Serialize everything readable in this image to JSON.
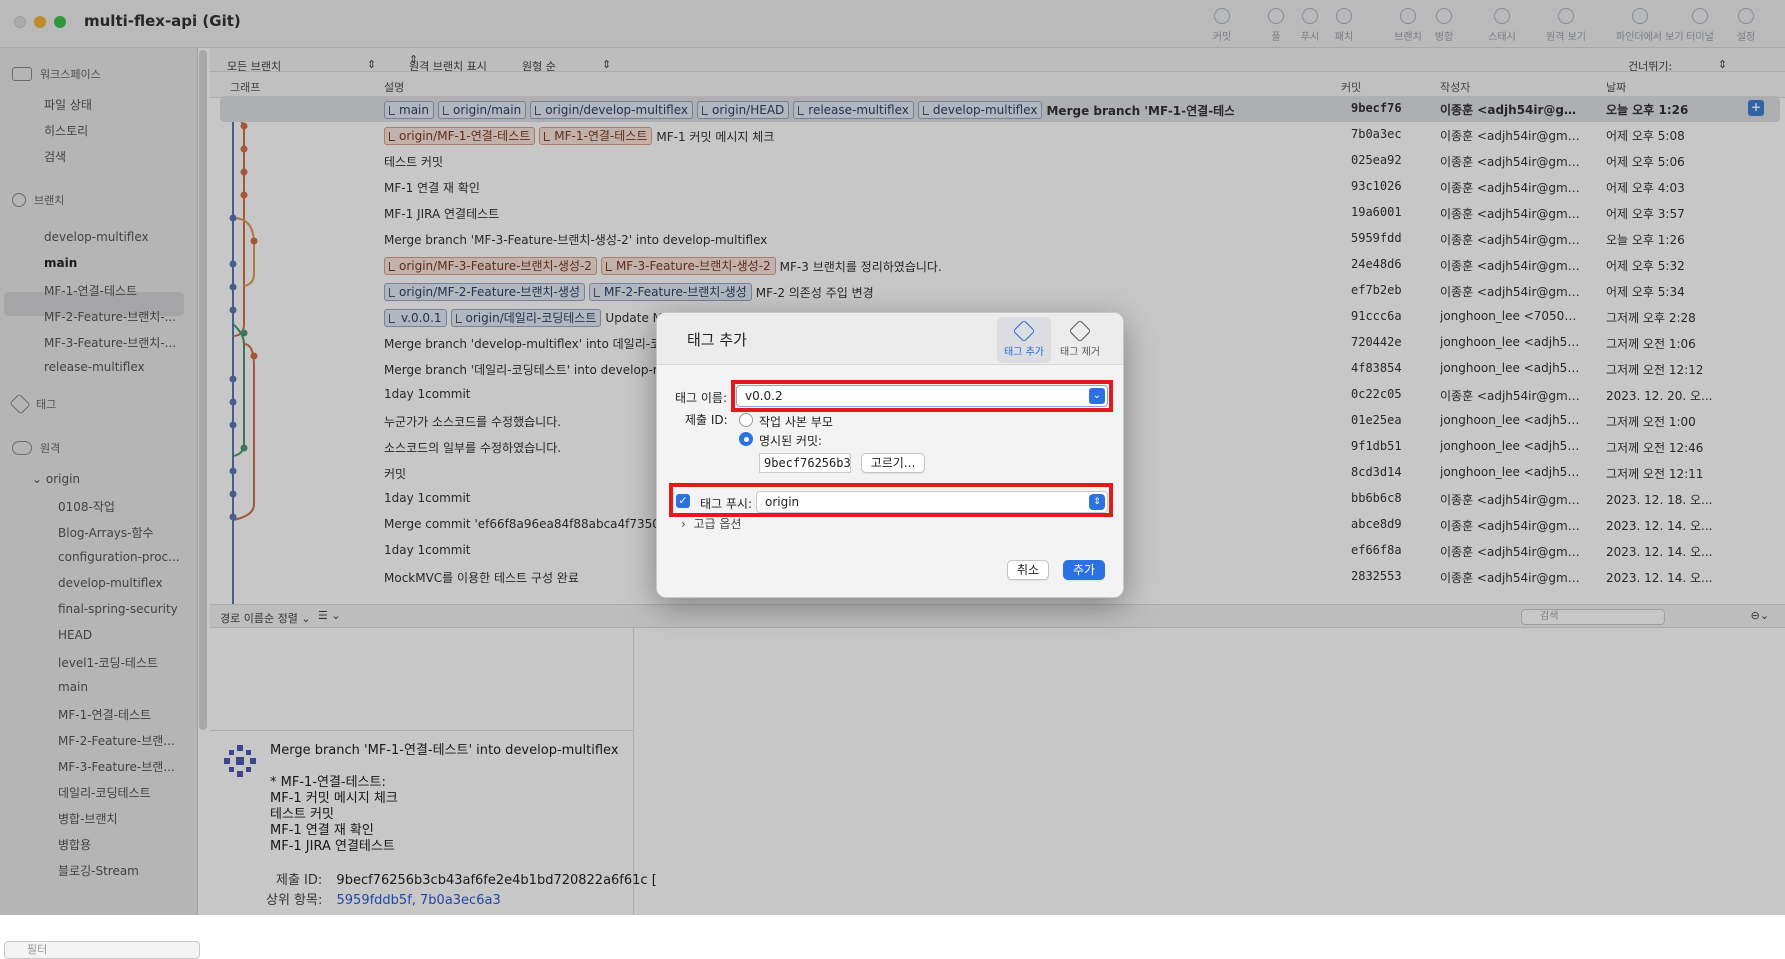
{
  "window": {
    "title": "multi-flex-api (Git)"
  },
  "toolbar": [
    {
      "label": "커밋",
      "icon": "commit-icon"
    },
    {
      "label": "풀",
      "icon": "pull-icon"
    },
    {
      "label": "푸시",
      "icon": "push-icon"
    },
    {
      "label": "패치",
      "icon": "fetch-icon"
    },
    {
      "label": "브랜치",
      "icon": "branch-icon"
    },
    {
      "label": "병합",
      "icon": "merge-icon"
    },
    {
      "label": "스태시",
      "icon": "stash-icon"
    },
    {
      "label": "원격 보기",
      "icon": "remote-icon"
    },
    {
      "label": "파인더에서 보기",
      "icon": "finder-icon"
    },
    {
      "label": "터미널",
      "icon": "terminal-icon"
    },
    {
      "label": "설정",
      "icon": "settings-icon"
    }
  ],
  "sidebar": {
    "workspace": "워크스페이스",
    "workspace_items": [
      "파일 상태",
      "히스토리",
      "검색"
    ],
    "branches": "브랜치",
    "branch_items": [
      "develop-multiflex",
      "main",
      "MF-1-연결-테스트",
      "MF-2-Feature-브랜치-...",
      "MF-3-Feature-브랜치-...",
      "release-multiflex"
    ],
    "tags": "태그",
    "remotes": "원격",
    "origin": "origin",
    "remote_items": [
      "0108-작업",
      "Blog-Arrays-함수",
      "configuration-proc...",
      "develop-multiflex",
      "final-spring-security",
      "HEAD",
      "level1-코딩-테스트",
      "main",
      "MF-1-연결-테스트",
      "MF-2-Feature-브랜...",
      "MF-3-Feature-브랜...",
      "데일리-코딩테스트",
      "병합-브랜치",
      "병합용",
      "블로깅-Stream"
    ],
    "filter_placeholder": "필터"
  },
  "filters": {
    "branches": "모든 브랜치",
    "remote": "원격 브랜치 표시",
    "order": "원형 순",
    "jump": "건너뛰기:"
  },
  "columns": {
    "graph": "그래프",
    "desc": "설명",
    "commit": "커밋",
    "author": "작성자",
    "date": "날짜"
  },
  "commits": [
    {
      "tags": [
        {
          "t": "main",
          "c": "b"
        },
        {
          "t": "origin/main",
          "c": "b"
        },
        {
          "t": "origin/develop-multiflex",
          "c": "b"
        },
        {
          "t": "origin/HEAD",
          "c": "b"
        },
        {
          "t": "release-multiflex",
          "c": "b"
        },
        {
          "t": "develop-multiflex",
          "c": "b"
        }
      ],
      "msg": "Merge branch 'MF-1-연결-테스트' into develop-multiflex",
      "hash": "9becf76",
      "author": "이종훈 <adjh54ir@gmail.co...",
      "date": "오늘 오후 1:26",
      "bold": true
    },
    {
      "tags": [
        {
          "t": "origin/MF-1-연결-테스트",
          "c": "o"
        },
        {
          "t": "MF-1-연결-테스트",
          "c": "o"
        }
      ],
      "msg": "MF-1 커밋 메시지 체크",
      "hash": "7b0a3ec",
      "author": "이종훈 <adjh54ir@gmail.co...",
      "date": "어제 오후 5:08"
    },
    {
      "tags": [],
      "msg": "테스트 커밋",
      "hash": "025ea92",
      "author": "이종훈 <adjh54ir@gmail.co...",
      "date": "어제 오후 5:06"
    },
    {
      "tags": [],
      "msg": "MF-1 연결 재 확인",
      "hash": "93c1026",
      "author": "이종훈 <adjh54ir@gmail.co...",
      "date": "어제 오후 4:03"
    },
    {
      "tags": [],
      "msg": "MF-1 JIRA 연결테스트",
      "hash": "19a6001",
      "author": "이종훈 <adjh54ir@gmail.co...",
      "date": "어제 오후 3:57"
    },
    {
      "tags": [],
      "msg": "Merge branch 'MF-3-Feature-브랜치-생성-2' into develop-multiflex",
      "hash": "5959fdd",
      "author": "이종훈 <adjh54ir@gmail.co...",
      "date": "오늘 오후 1:26"
    },
    {
      "tags": [
        {
          "t": "origin/MF-3-Feature-브랜치-생성-2",
          "c": "o"
        },
        {
          "t": "MF-3-Feature-브랜치-생성-2",
          "c": "o"
        }
      ],
      "msg": "MF-3 브랜치를 정리하였습니다.",
      "hash": "24e48d6",
      "author": "이종훈 <adjh54ir@gmail.co...",
      "date": "어제 오후 5:32"
    },
    {
      "tags": [
        {
          "t": "origin/MF-2-Feature-브랜치-생성",
          "c": "b"
        },
        {
          "t": "MF-2-Feature-브랜치-생성",
          "c": "b"
        }
      ],
      "msg": "MF-2 의존성 주입 변경",
      "hash": "ef7b2eb",
      "author": "이종훈 <adjh54ir@gmail.co...",
      "date": "어제 오후 5:34"
    },
    {
      "tags": [
        {
          "t": "v.0.0.1",
          "c": "t"
        },
        {
          "t": "origin/데일리-코딩테스트",
          "c": "b"
        }
      ],
      "msg": "Update Mult...",
      "hash": "91ccc6a",
      "author": "jonghoon_lee <70501374...",
      "date": "그저께 오후 2:28"
    },
    {
      "tags": [],
      "msg": "Merge branch 'develop-multiflex' into 데일리-코딩...",
      "hash": "720442e",
      "author": "jonghoon_lee <adjh54ir@...",
      "date": "그저께 오전 1:06"
    },
    {
      "tags": [],
      "msg": "Merge branch '데일리-코딩테스트' into develop-mu...",
      "hash": "4f83854",
      "author": "jonghoon_lee <adjh54ir@...",
      "date": "그저께 오전 12:12"
    },
    {
      "tags": [],
      "msg": "1day 1commit",
      "hash": "0c22c05",
      "author": "이종훈 <adjh54ir@gmail.co...",
      "date": "2023. 12. 20. 오..."
    },
    {
      "tags": [],
      "msg": "누군가가 소스코드를 수정했습니다.",
      "hash": "01e25ea",
      "author": "jonghoon_lee <adjh54ir@...",
      "date": "그저께 오전 1:00"
    },
    {
      "tags": [],
      "msg": "소스코드의 일부를 수정하였습니다.",
      "hash": "9f1db51",
      "author": "jonghoon_lee <adjh54ir@...",
      "date": "그저께 오전 12:46"
    },
    {
      "tags": [],
      "msg": "커밋",
      "hash": "8cd3d14",
      "author": "jonghoon_lee <adjh54ir@...",
      "date": "그저께 오전 12:11"
    },
    {
      "tags": [],
      "msg": "1day 1commit",
      "hash": "bb6b6c8",
      "author": "이종훈 <adjh54ir@gmail.co...",
      "date": "2023. 12. 18. 오..."
    },
    {
      "tags": [],
      "msg": "Merge commit 'ef66f8a96ea84f88abca4f73501...",
      "hash": "abce8d9",
      "author": "이종훈 <adjh54ir@gmail.co...",
      "date": "2023. 12. 14. 오..."
    },
    {
      "tags": [],
      "msg": "1day 1commit",
      "hash": "ef66f8a",
      "author": "이종훈 <adjh54ir@gmail.co...",
      "date": "2023. 12. 14. 오..."
    },
    {
      "tags": [],
      "msg": "MockMVC를 이용한 테스트 구성 완료",
      "hash": "2832553",
      "author": "이종훈 <adjh54ir@gmail.co...",
      "date": "2023. 12. 14. 오..."
    }
  ],
  "bottom": {
    "sort": "경로 이름순 정렬",
    "search_placeholder": "검색"
  },
  "detail": {
    "message": "Merge branch 'MF-1-연결-테스트' into develop-multiflex\n\n* MF-1-연결-테스트:\nMF-1 커밋 메시지 체크\n테스트 커밋\nMF-1 연결 재 확인\nMF-1 JIRA 연결테스트",
    "commit_id_label": "제출 ID:",
    "commit_id": "9becf76256b3cb43af6fe2e4b1bd720822a6f61c [",
    "parents_label": "상위 항목:",
    "parents": "5959fddb5f, 7b0a3ec6a3"
  },
  "dialog": {
    "title": "태그 추가",
    "tab_add": "태그 추가",
    "tab_remove": "태그 제거",
    "tag_name_label": "태그 이름:",
    "tag_name_value": "v0.0.2",
    "commit_label": "제출 ID:",
    "opt_working": "작업 사본 부모",
    "opt_specific": "명시된 커밋:",
    "commit_hash": "9becf76256b3",
    "choose": "고르기...",
    "push_label": "태그 푸시:",
    "push_remote": "origin",
    "advanced": "고급 옵션",
    "cancel": "취소",
    "add": "추가"
  }
}
